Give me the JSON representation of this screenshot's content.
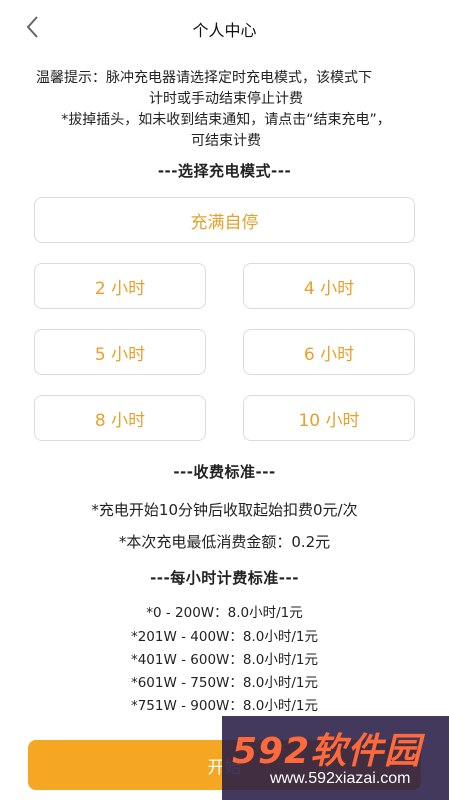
{
  "header": {
    "title": "个人中心",
    "back_icon": "chevron-left-icon"
  },
  "notice": {
    "line1": "温馨提示：脉冲充电器请选择定时充电模式，该模式下",
    "line2": "计时或手动结束停止计费",
    "line3": "*拔掉插头，如未收到结束通知，请点击“结束充电”，",
    "line4": "可结束计费"
  },
  "mode_section": {
    "title": "---选择充电模式---"
  },
  "options": {
    "full": "充满自停",
    "h2": "2 小时",
    "h4": "4 小时",
    "h5": "5 小时",
    "h6": "6 小时",
    "h8": "8 小时",
    "h10": "10 小时",
    "text_color": "#e8a02a"
  },
  "fee_section": {
    "title": "---收费标准---",
    "line1": "*充电开始10分钟后收取起始扣费0元/次",
    "line2": "*本次充电最低消费金额：0.2元"
  },
  "rate_section": {
    "title": "---每小时计费标准---",
    "rows": [
      "*0 - 200W：8.0小时/1元",
      "*201W - 400W：8.0小时/1元",
      "*401W - 600W：8.0小时/1元",
      "*601W - 750W：8.0小时/1元",
      "*751W - 900W：8.0小时/1元"
    ]
  },
  "start_button": {
    "label": "开始",
    "color": "#f5a623"
  },
  "watermark": {
    "main": "592软件园",
    "url": "www.592xiazai.com"
  }
}
